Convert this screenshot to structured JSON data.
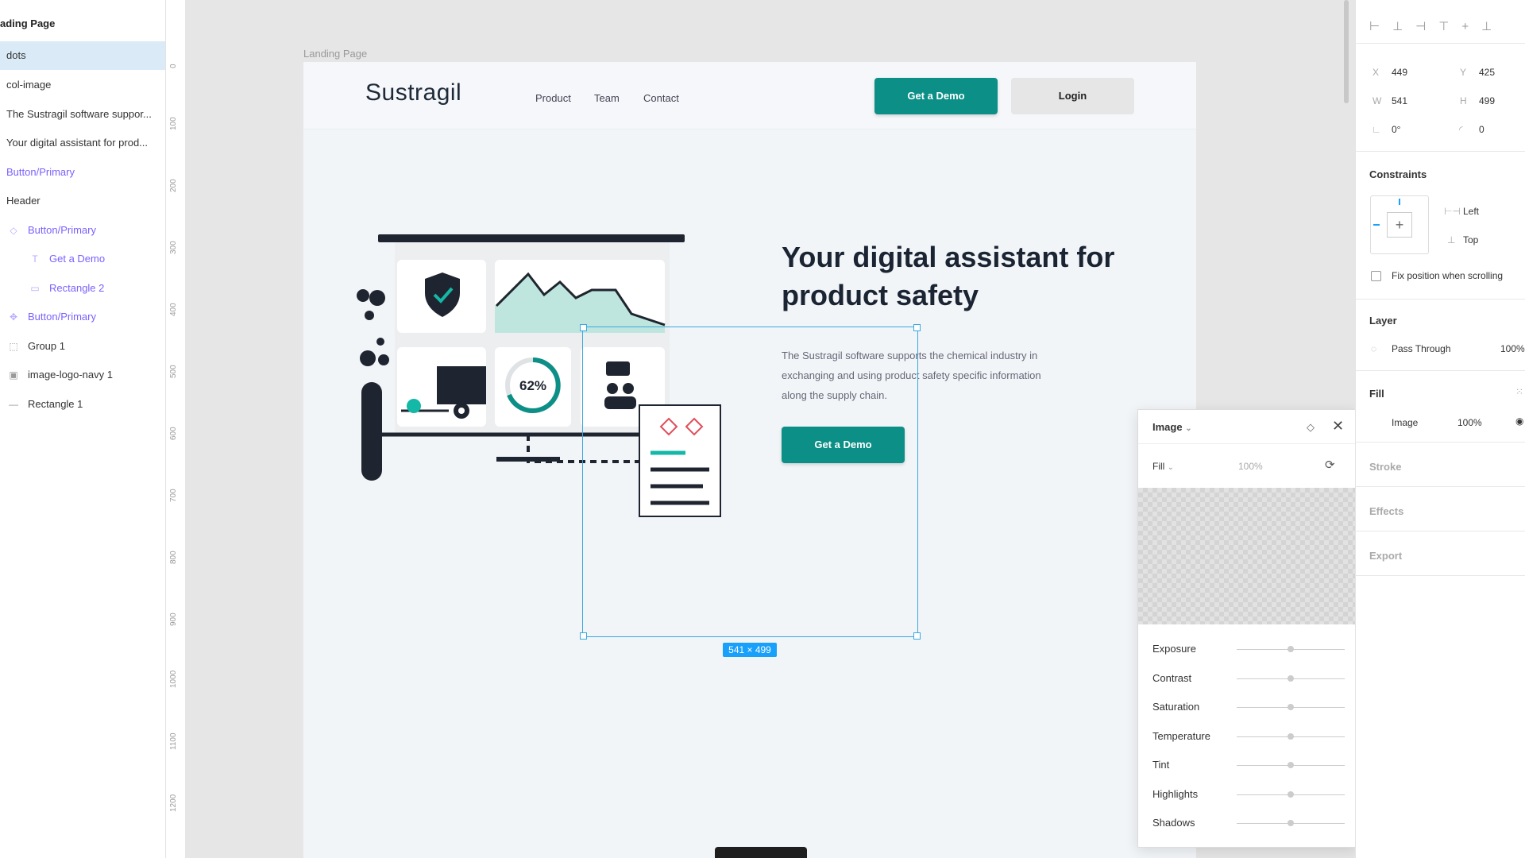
{
  "layers_panel": {
    "page_name": "ading Page",
    "items": [
      {
        "label": "dots",
        "selected": true
      },
      {
        "label": "col-image"
      },
      {
        "label": "The Sustragil software suppor..."
      },
      {
        "label": "Your digital assistant for prod..."
      },
      {
        "label": "Button/Primary",
        "component": true
      },
      {
        "label": "Header"
      },
      {
        "label": "Button/Primary",
        "component": true,
        "icon": "component-diamond-icon"
      },
      {
        "label": "Get a Demo",
        "component": true,
        "icon": "text-icon"
      },
      {
        "label": "Rectangle 2",
        "component": true,
        "icon": "rectangle-icon"
      },
      {
        "label": "Button/Primary",
        "component": true,
        "icon": "component-icon"
      },
      {
        "label": "Group 1",
        "icon": "group-icon"
      },
      {
        "label": "image-logo-navy 1",
        "icon": "image-icon"
      },
      {
        "label": "Rectangle 1",
        "icon": "line-icon"
      }
    ]
  },
  "ruler": {
    "ticks": [
      "0",
      "100",
      "200",
      "300",
      "400",
      "500",
      "600",
      "700",
      "800",
      "900",
      "1000",
      "1100",
      "1200"
    ]
  },
  "canvas": {
    "frame_label": "Landing Page",
    "selection_size": "541 × 499"
  },
  "site": {
    "logo": "Sustragil",
    "nav": [
      "Product",
      "Team",
      "Contact"
    ],
    "header_cta": "Get a Demo",
    "login": "Login",
    "headline": "Your digital assistant for product safety",
    "body": "The Sustragil software supports the chemical industry in exchanging and using product safety specific information along the supply chain.",
    "hero_cta": "Get a Demo",
    "gauge": "62%"
  },
  "properties": {
    "x_label": "X",
    "x": "449",
    "y_label": "Y",
    "y": "425",
    "w_label": "W",
    "w": "541",
    "h_label": "H",
    "h": "499",
    "rotation": "0°",
    "radius": "0",
    "constraints_title": "Constraints",
    "constraint_h": "Left",
    "constraint_v": "Top",
    "fix_position": "Fix position when scrolling",
    "layer_title": "Layer",
    "blend": "Pass Through",
    "layer_opacity": "100%",
    "fill_title": "Fill",
    "fill_type": "Image",
    "fill_opacity": "100%",
    "stroke_title": "Stroke",
    "effects_title": "Effects",
    "export_title": "Export"
  },
  "image_popover": {
    "title": "Image",
    "mode": "Fill",
    "opacity": "100%",
    "adjustments": [
      {
        "label": "Exposure",
        "value": 0.5
      },
      {
        "label": "Contrast",
        "value": 0.5
      },
      {
        "label": "Saturation",
        "value": 0.5
      },
      {
        "label": "Temperature",
        "value": 0.5
      },
      {
        "label": "Tint",
        "value": 0.5
      },
      {
        "label": "Highlights",
        "value": 0.5
      },
      {
        "label": "Shadows",
        "value": 0.5
      }
    ]
  },
  "colors": {
    "brand_teal": "#0c8f86",
    "selection_blue": "#38a8e0",
    "component_purple": "#7b61ff"
  }
}
